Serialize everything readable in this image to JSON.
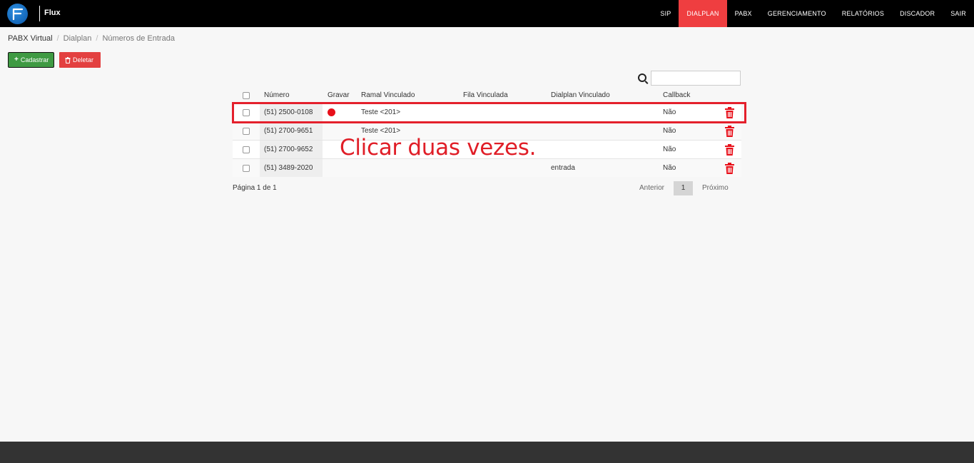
{
  "app": {
    "name": "Flux"
  },
  "nav": [
    {
      "label": "SIP",
      "active": false
    },
    {
      "label": "DIALPLAN",
      "active": true
    },
    {
      "label": "PABX",
      "active": false
    },
    {
      "label": "GERENCIAMENTO",
      "active": false
    },
    {
      "label": "RELATÓRIOS",
      "active": false
    },
    {
      "label": "DISCADOR",
      "active": false
    },
    {
      "label": "SAIR",
      "active": false
    }
  ],
  "breadcrumb": [
    "PABX Virtual",
    "Dialplan",
    "Números de Entrada"
  ],
  "toolbar": {
    "add_label": "Cadastrar",
    "add_icon": "plus-icon",
    "delete_label": "Deletar",
    "delete_icon": "trash-icon"
  },
  "search": {
    "value": "",
    "placeholder": ""
  },
  "table": {
    "headers": {
      "numero": "Número",
      "gravar": "Gravar",
      "ramal": "Ramal Vinculado",
      "fila": "Fila Vinculada",
      "dialplan": "Dialplan Vinculado",
      "callback": "Callback"
    },
    "rows": [
      {
        "numero": "(51) 2500-0108",
        "gravar": true,
        "ramal": "Teste <201>",
        "fila": "",
        "dialplan": "",
        "callback": "Não"
      },
      {
        "numero": "(51) 2700-9651",
        "gravar": false,
        "ramal": "Teste <201>",
        "fila": "",
        "dialplan": "",
        "callback": "Não"
      },
      {
        "numero": "(51) 2700-9652",
        "gravar": false,
        "ramal": "",
        "fila": "",
        "dialplan": "",
        "callback": "Não"
      },
      {
        "numero": "(51) 3489-2020",
        "gravar": false,
        "ramal": "",
        "fila": "",
        "dialplan": "entrada",
        "callback": "Não"
      }
    ]
  },
  "annotation": "Clicar duas vezes.",
  "pagination": {
    "info": "Página 1 de 1",
    "prev": "Anterior",
    "current": "1",
    "next": "Próximo"
  },
  "colors": {
    "accent": "#ef3e40",
    "success": "#3f9a43",
    "danger": "#e34040",
    "highlight": "#e4202c"
  }
}
